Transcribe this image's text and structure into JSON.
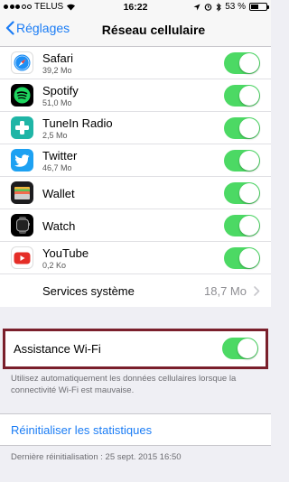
{
  "status_bar": {
    "carrier": "TELUS",
    "time": "16:22",
    "battery": "53 %",
    "battery_level": 0.53
  },
  "nav": {
    "back_label": "Réglages",
    "title": "Réseau cellulaire"
  },
  "apps": [
    {
      "name": "Safari",
      "size": "39,2 Mo",
      "on": true
    },
    {
      "name": "Spotify",
      "size": "51,0 Mo",
      "on": true
    },
    {
      "name": "TuneIn Radio",
      "size": "2,5 Mo",
      "on": true
    },
    {
      "name": "Twitter",
      "size": "46,7 Mo",
      "on": true
    },
    {
      "name": "Wallet",
      "size": "",
      "on": true
    },
    {
      "name": "Watch",
      "size": "",
      "on": true
    },
    {
      "name": "YouTube",
      "size": "0,2 Ko",
      "on": true
    }
  ],
  "system_services": {
    "label": "Services système",
    "value": "18,7 Mo"
  },
  "wifi_assist": {
    "label": "Assistance Wi-Fi",
    "on": true,
    "description": "Utilisez automatiquement les données cellulaires lorsque la connectivité Wi-Fi est mauvaise."
  },
  "reset": {
    "label": "Réinitialiser les statistiques",
    "last_reset": "Dernière réinitialisation : 25 sept. 2015 16:50"
  },
  "colors": {
    "accent": "#1a7cf5",
    "toggle_on": "#4cd964",
    "highlight_border": "#7a1f2b"
  }
}
